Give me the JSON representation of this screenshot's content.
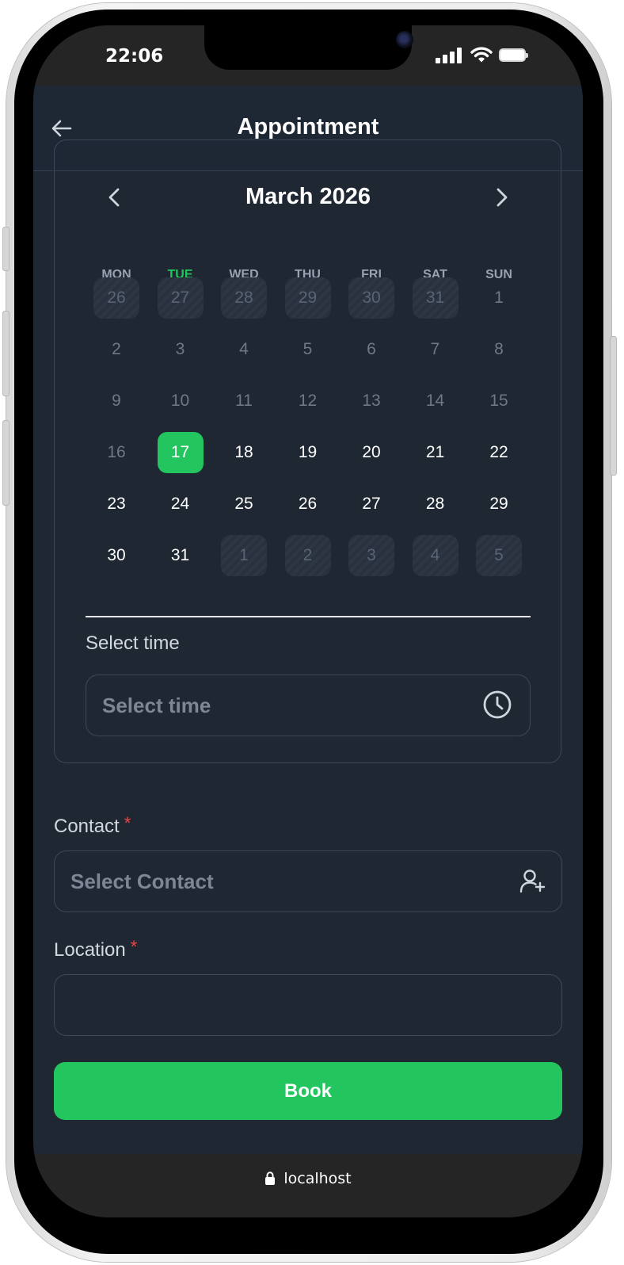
{
  "status_bar": {
    "time": "22:06"
  },
  "header": {
    "title": "Appointment",
    "back_icon": "arrow-left-icon"
  },
  "calendar": {
    "month_label": "March 2026",
    "prev_icon": "chevron-left-icon",
    "next_icon": "chevron-right-icon",
    "weekdays": [
      "MON",
      "TUE",
      "WED",
      "THU",
      "FRI",
      "SAT",
      "SUN"
    ],
    "today_weekday": "TUE",
    "weeks": [
      [
        "26",
        "27",
        "28",
        "29",
        "30",
        "31",
        "1"
      ],
      [
        "2",
        "3",
        "4",
        "5",
        "6",
        "7",
        "8"
      ],
      [
        "9",
        "10",
        "11",
        "12",
        "13",
        "14",
        "15"
      ],
      [
        "16",
        "17",
        "18",
        "19",
        "20",
        "21",
        "22"
      ],
      [
        "23",
        "24",
        "25",
        "26",
        "27",
        "28",
        "29"
      ],
      [
        "30",
        "31",
        "1",
        "2",
        "3",
        "4",
        "5"
      ]
    ],
    "selected_day": "17",
    "colors": {
      "accent": "#22c55e",
      "background": "#1f2733"
    }
  },
  "time_field": {
    "label": "Select time",
    "placeholder": "Select time",
    "icon": "clock-icon"
  },
  "contact_field": {
    "label": "Contact",
    "required_mark": "*",
    "placeholder": "Select Contact",
    "icon": "user-plus-icon"
  },
  "location_field": {
    "label": "Location",
    "required_mark": "*",
    "value": ""
  },
  "book_button": {
    "label": "Book"
  },
  "browser": {
    "url": "localhost",
    "lock_icon": "lock-icon"
  }
}
